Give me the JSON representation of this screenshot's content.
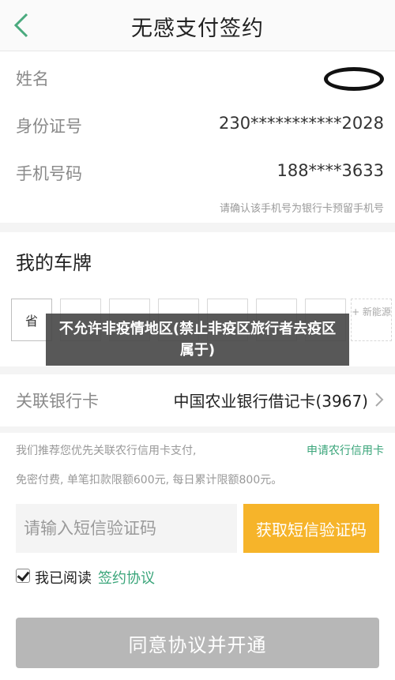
{
  "header": {
    "title": "无感支付签约"
  },
  "profile": {
    "name_label": "姓名",
    "id_label": "身份证号",
    "id_value": "230***********2028",
    "phone_label": "手机号码",
    "phone_value": "188****3633",
    "phone_hint": "请确认该手机号为银行卡预留手机号"
  },
  "plate": {
    "title": "我的车牌",
    "first_char": "省",
    "new_energy_label": "+ 新能源"
  },
  "overlay": {
    "text": "不允许非疫情地区(禁止非疫区旅行者去疫区属于)"
  },
  "bank": {
    "label": "关联银行卡",
    "value": "中国农业银行借记卡(3967)"
  },
  "promo": {
    "line1": "我们推荐您优先关联农行信用卡支付,",
    "link": "申请农行信用卡",
    "line2": "免密付费, 单笔扣款限额600元, 每日累计限额800元。"
  },
  "sms": {
    "placeholder": "请输入短信验证码",
    "button_label": "获取短信验证码"
  },
  "agreement": {
    "checked": true,
    "text": "我已阅读",
    "link": "签约协议"
  },
  "submit": {
    "label": "同意协议并开通"
  },
  "colors": {
    "accent_green": "#3aa57a",
    "sms_button": "#f6b42a",
    "submit_disabled": "#b7b7b7"
  }
}
